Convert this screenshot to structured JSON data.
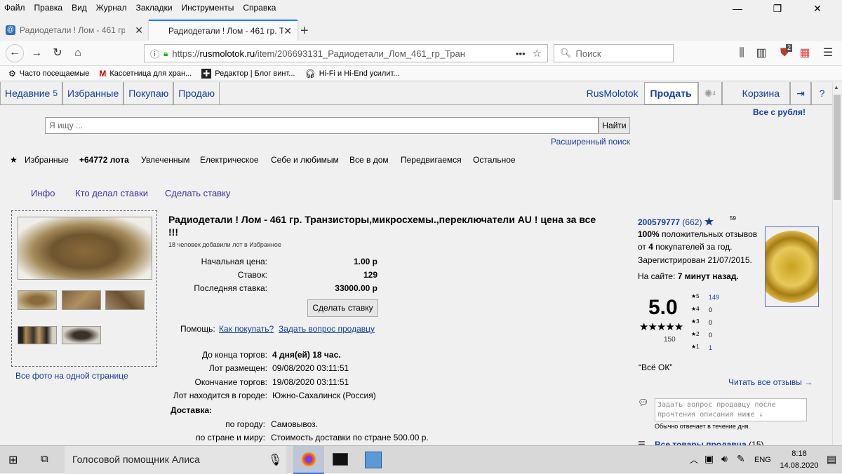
{
  "menu": [
    "Файл",
    "Правка",
    "Вид",
    "Журнал",
    "Закладки",
    "Инструменты",
    "Справка"
  ],
  "tabs": [
    {
      "label": "Радиодетали ! Лом - 461 гр. Тр"
    },
    {
      "label": "Радиодетали ! Лом - 461 гр. Тр"
    }
  ],
  "url": {
    "prefix": "https://",
    "host": "rusmolotok.ru",
    "path": "/item/206693131_Радиодетали_Лом_461_гр_Транзисто",
    "menu_dots": "•••"
  },
  "search_placeholder": "Поиск",
  "toolbar": {
    "badge_count": "2"
  },
  "bookmarks": [
    "Часто посещаемые",
    "Кассетница для хран...",
    "Редактор | Блог винт...",
    "Hi-Fi и Hi-End усилит..."
  ],
  "site": {
    "nav": [
      {
        "label": "Недавние",
        "count": "5"
      },
      {
        "label": "Избранные"
      },
      {
        "label": "Покупаю"
      },
      {
        "label": "Продаю"
      }
    ],
    "name": "RusMolotok",
    "sell": "Продать",
    "notif_count": "4",
    "cart": "Корзина",
    "promo": "Все с рубля!",
    "search_placeholder": "Я ищу ...",
    "search_button": "Найти",
    "advanced": "Расширенный поиск",
    "categories": [
      "Избранные",
      "+64772 лота",
      "Увлеченным",
      "Електрическое",
      "Себе и любимым",
      "Все в дом",
      "Передвигаемся",
      "Остальное"
    ],
    "subtabs": [
      "Инфо",
      "Кто делал ставки",
      "Сделать ставку"
    ]
  },
  "lot": {
    "title": "Радиодетали ! Лом - 461 гр. Транзисторы,микросхемы.,переключатели AU ! цена за все",
    "title2": "!!!",
    "favs": "18 человек добавили лот в Избранное",
    "rows": [
      {
        "label": "Начальная цена:",
        "value": "1.00 р"
      },
      {
        "label": "Ставок:",
        "value": "129"
      },
      {
        "label": "Последняя ставка:",
        "value": "33000.00 р"
      }
    ],
    "bid_button": "Сделать ставку",
    "help_label": "Помощь:",
    "help_link1": "Как покупать?",
    "help_link2": "Задать вопрос продавцу",
    "info": [
      {
        "label": "До конца торгов:",
        "value": "4 дня(ей) 18 час."
      },
      {
        "label": "Лот размещен:",
        "value": "09/08/2020 03:11:51"
      },
      {
        "label": "Окончание торгов:",
        "value": "19/08/2020 03:11:51"
      },
      {
        "label": "Лот находится в городе:",
        "value": "Южно-Сахалинск (Россия)"
      }
    ],
    "delivery_title": "Доставка:",
    "delivery": [
      {
        "label": "по городу:",
        "value": "Самовывоз."
      },
      {
        "label": "по стране и миру:",
        "value": "Стоимость доставки по стране 500.00 р."
      }
    ],
    "all_photos": "Все фото на одной странице"
  },
  "seller": {
    "id": "200579777",
    "count": "(662)",
    "small": "59",
    "positive_pct": "100%",
    "positive_text": " положительных отзывов",
    "from_text": "от ",
    "buyers": "4",
    "buyers_text": " покупателей за год.",
    "registered": "Зарегистрирован 21/07/2015.",
    "online_label": "На сайте: ",
    "online_value": "7 минут назад.",
    "rating": "5.0",
    "stars": "★★★★★",
    "rating_count": "150",
    "breakdown": [
      {
        "star": "5",
        "count": "149"
      },
      {
        "star": "4",
        "count": "0"
      },
      {
        "star": "3",
        "count": "0"
      },
      {
        "star": "2",
        "count": "0"
      },
      {
        "star": "1",
        "count": "1"
      }
    ],
    "quote": "“Всё ОК”",
    "read_all": "Читать все отзывы →",
    "ask_placeholder": "Задать вопрос продавцу после прочтения описания ниже ↓",
    "reply_time": "Обычно отвечает в течение дня.",
    "all_items": "Все товары продавца",
    "all_items_count": "(15)"
  },
  "taskbar": {
    "assistant": "Голосовой помощник Алиса",
    "lang": "ENG",
    "time": "8:18",
    "date": "14.08.2020"
  },
  "colors": {
    "link": "#123d9e",
    "accent_tab": "#0a84ff",
    "lock": "#12bc00"
  }
}
